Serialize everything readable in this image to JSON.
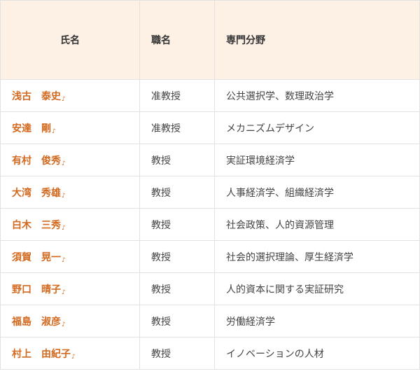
{
  "table": {
    "headers": {
      "name": "氏名",
      "title": "職名",
      "specialty": "専門分野"
    },
    "rows": [
      {
        "name": "浅古　泰史",
        "title": "准教授",
        "specialty": "公共選択学、数理政治学"
      },
      {
        "name": "安達　剛",
        "title": "准教授",
        "specialty": "メカニズムデザイン"
      },
      {
        "name": "有村　俊秀",
        "title": "教授",
        "specialty": "実証環境経済学"
      },
      {
        "name": "大湾　秀雄",
        "title": "教授",
        "specialty": "人事経済学、組織経済学"
      },
      {
        "name": "白木　三秀",
        "title": "教授",
        "specialty": "社会政策、人的資源管理"
      },
      {
        "name": "須賀　晃一",
        "title": "教授",
        "specialty": "社会的選択理論、厚生経済学"
      },
      {
        "name": "野口　晴子",
        "title": "教授",
        "specialty": "人的資本に関する実証研究"
      },
      {
        "name": "福島　淑彦",
        "title": "教授",
        "specialty": "労働経済学"
      },
      {
        "name": "村上　由紀子",
        "title": "教授",
        "specialty": "イノベーションの人材"
      }
    ],
    "link_icon": "♪",
    "link_icon_name": "external-link-icon",
    "accent_color": "#d2691e",
    "header_bg": "#fdf1e6"
  }
}
